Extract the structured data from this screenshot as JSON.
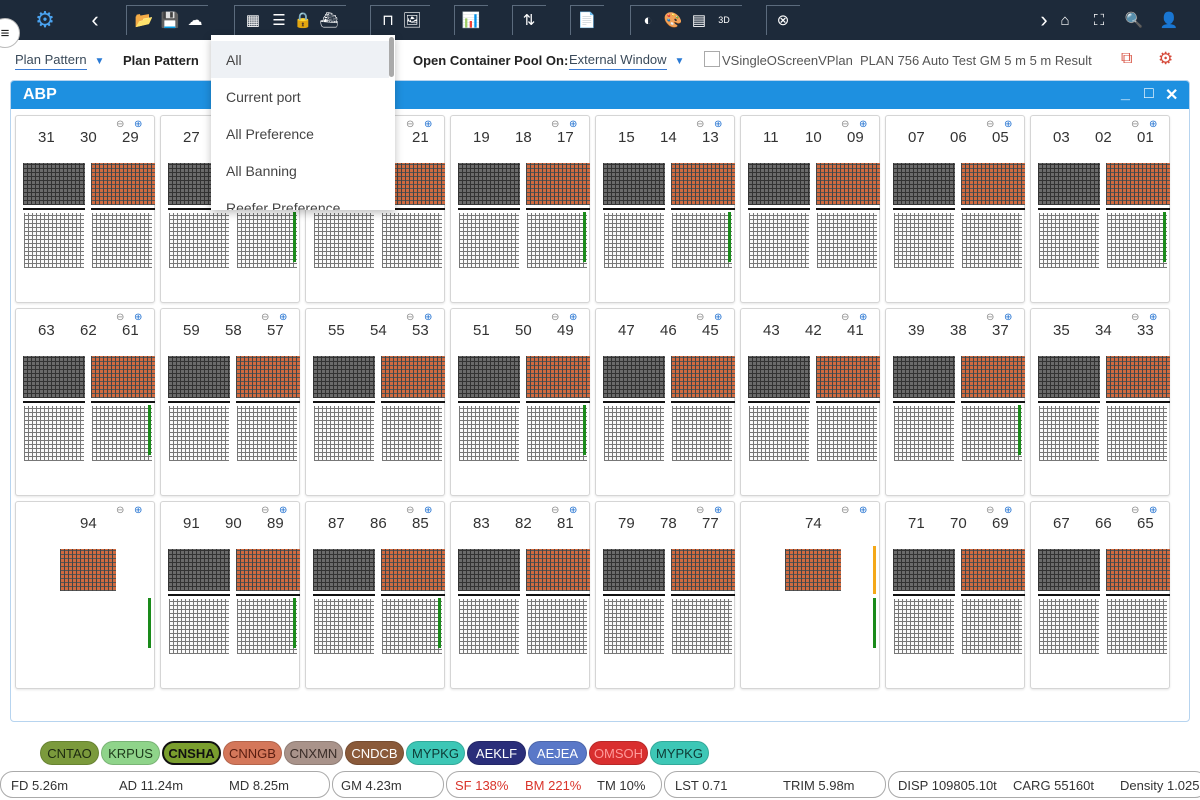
{
  "toolbar": {
    "labels": {
      "three_d": "3D"
    }
  },
  "subbar": {
    "plan_select": "Plan Pattern",
    "plan_label": "Plan Pattern",
    "pool_label": "Open Container Pool On:",
    "window_select": "External Window",
    "overlap_text": "VSingleOScreenVPlan",
    "result_text": "PLAN 756 Auto Test GM 5 m 5 m Result"
  },
  "dropdown": {
    "items": [
      "All",
      "Current port",
      "All Preference",
      "All Banning",
      "Reefer Preference"
    ]
  },
  "panel": {
    "title": "ABP"
  },
  "bays": [
    [
      "31",
      "30",
      "29"
    ],
    [
      "27",
      "",
      ""
    ],
    [
      "",
      "",
      "21"
    ],
    [
      "19",
      "18",
      "17"
    ],
    [
      "15",
      "14",
      "13"
    ],
    [
      "11",
      "10",
      "09"
    ],
    [
      "07",
      "06",
      "05"
    ],
    [
      "03",
      "02",
      "01"
    ],
    [
      "63",
      "62",
      "61"
    ],
    [
      "59",
      "58",
      "57"
    ],
    [
      "55",
      "54",
      "53"
    ],
    [
      "51",
      "50",
      "49"
    ],
    [
      "47",
      "46",
      "45"
    ],
    [
      "43",
      "42",
      "41"
    ],
    [
      "39",
      "38",
      "37"
    ],
    [
      "35",
      "34",
      "33"
    ],
    [
      "",
      "94",
      ""
    ],
    [
      "91",
      "90",
      "89"
    ],
    [
      "87",
      "86",
      "85"
    ],
    [
      "83",
      "82",
      "81"
    ],
    [
      "79",
      "78",
      "77"
    ],
    [
      "",
      "74",
      ""
    ],
    [
      "71",
      "70",
      "69"
    ],
    [
      "67",
      "66",
      "65"
    ]
  ],
  "ports": [
    {
      "code": "CNTAO",
      "color": "#7b9a3c",
      "text": "#1d2a10"
    },
    {
      "code": "KRPUS",
      "color": "#8fd48a",
      "text": "#1d3a1a"
    },
    {
      "code": "CNSHA",
      "color": "#7a9e2e",
      "text": "#111"
    },
    {
      "code": "CNNGB",
      "color": "#d4775a",
      "text": "#5a1d10"
    },
    {
      "code": "CNXMN",
      "color": "#a9938a",
      "text": "#3a2d28"
    },
    {
      "code": "CNDCB",
      "color": "#8a5a3a",
      "text": "#fff"
    },
    {
      "code": "MYPKG",
      "color": "#3dc7b6",
      "text": "#0d3a35"
    },
    {
      "code": "AEKLF",
      "color": "#2a2e7a",
      "text": "#fff"
    },
    {
      "code": "AEJEA",
      "color": "#5a78c8",
      "text": "#fff"
    },
    {
      "code": "OMSOH",
      "color": "#d92f2f",
      "text": "#ff9a9a"
    },
    {
      "code": "MYPKG2",
      "label": "MYPKG",
      "color": "#3dc7b6",
      "text": "#0d3a35"
    }
  ],
  "status": {
    "fd": "FD 5.26m",
    "ad": "AD 11.24m",
    "md": "MD 8.25m",
    "gm": "GM 4.23m",
    "sf": "SF 138%",
    "bm": "BM 221%",
    "tm": "TM 10%",
    "lst": "LST 0.71",
    "trim": "TRIM 5.98m",
    "disp": "DISP 109805.10t",
    "carg": "CARG 55160t",
    "density": "Density 1.025"
  }
}
